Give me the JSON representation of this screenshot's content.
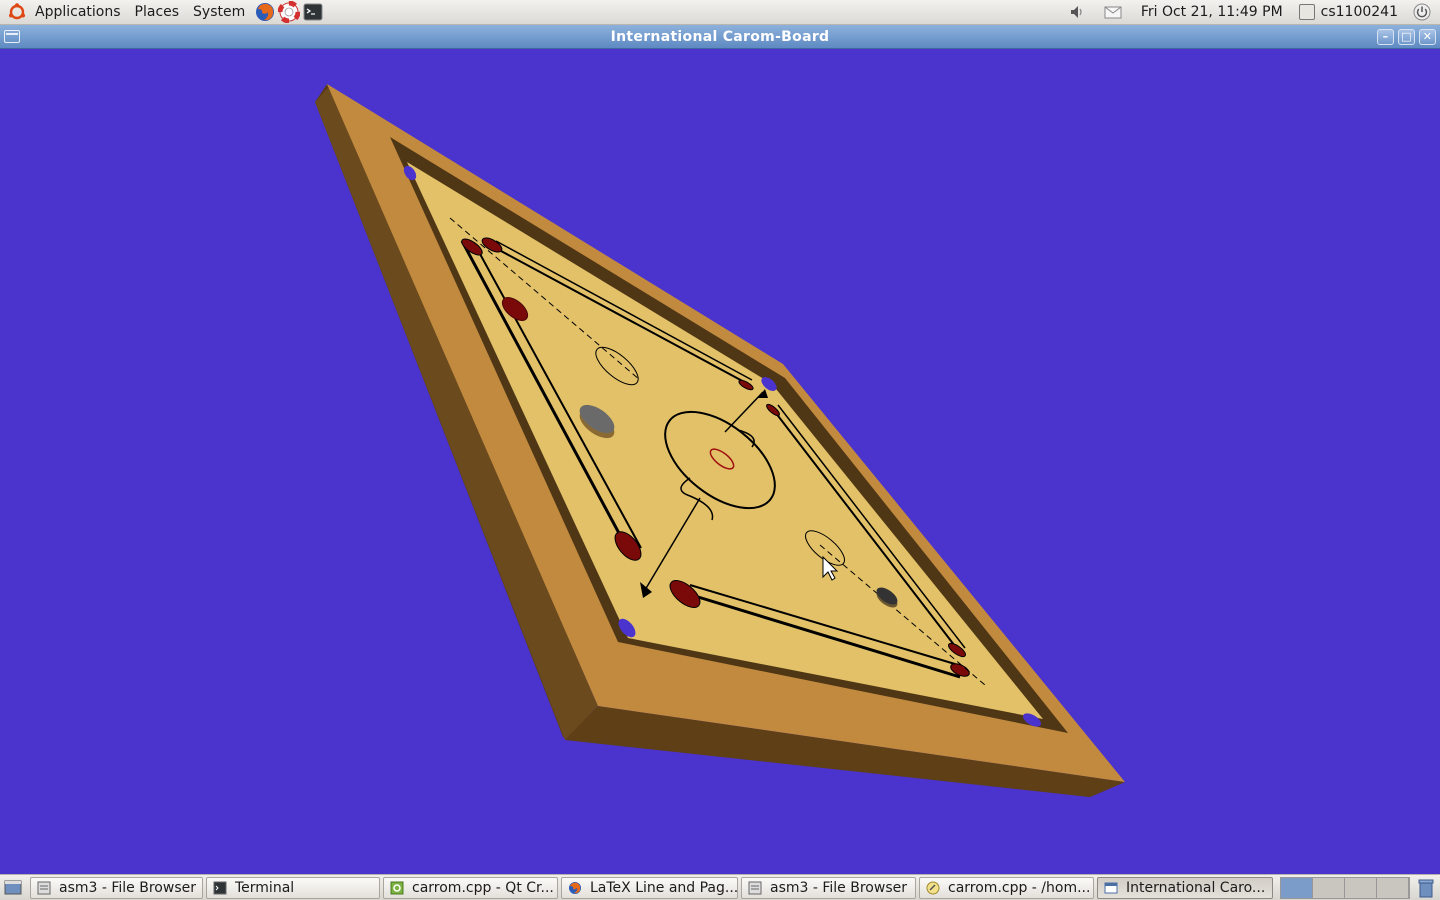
{
  "top_panel": {
    "menus": [
      "Applications",
      "Places",
      "System"
    ],
    "clock": "Fri Oct 21, 11:49 PM",
    "user": "cs1100241"
  },
  "window": {
    "title": "International Carom-Board",
    "controls": [
      "minimize",
      "maximize",
      "close"
    ]
  },
  "board": {
    "background_color": "#4b33cd",
    "frame_color": "#c28a3e",
    "frame_dark_color": "#5a3d18",
    "surface_color": "#e2c168",
    "line_color": "#000000",
    "red_color": "#7a0a0a",
    "pocket_color": "#4b33cd"
  },
  "taskbar": {
    "tasks": [
      {
        "label": "asm3 - File Browser",
        "icon": "file-browser-icon",
        "active": false
      },
      {
        "label": "Terminal",
        "icon": "terminal-icon",
        "active": false
      },
      {
        "label": "carrom.cpp - Qt Cr...",
        "icon": "qt-creator-icon",
        "active": false
      },
      {
        "label": "LaTeX Line and Pag...",
        "icon": "firefox-icon",
        "active": false
      },
      {
        "label": "asm3 - File Browser",
        "icon": "file-browser-icon",
        "active": false
      },
      {
        "label": "carrom.cpp - /hom...",
        "icon": "text-editor-icon",
        "active": false
      },
      {
        "label": "International Caro...",
        "icon": "window-icon",
        "active": true
      }
    ],
    "workspaces": 4,
    "active_workspace": 1
  }
}
